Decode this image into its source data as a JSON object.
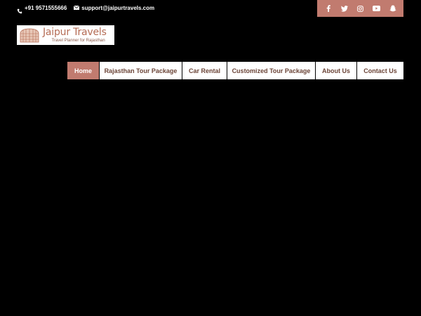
{
  "topbar": {
    "phone": "+91 9571555666",
    "email": "support@jaipurtravels.com"
  },
  "social": {
    "background": "#c17b6f",
    "icons": [
      "facebook-icon",
      "twitter-icon",
      "instagram-icon",
      "youtube-icon",
      "snapchat-icon"
    ]
  },
  "logo": {
    "title": "Jaipur Travels",
    "tagline": "Travel Planner for Rajasthan"
  },
  "nav": {
    "accent": "#c17b6f",
    "items": [
      {
        "label": "Home",
        "active": true
      },
      {
        "label": "Rajasthan Tour Package",
        "active": false
      },
      {
        "label": "Car Rental",
        "active": false
      },
      {
        "label": "Customized Tour Package",
        "active": false
      },
      {
        "label": "About Us",
        "active": false
      },
      {
        "label": "Contact Us",
        "active": false
      }
    ]
  }
}
